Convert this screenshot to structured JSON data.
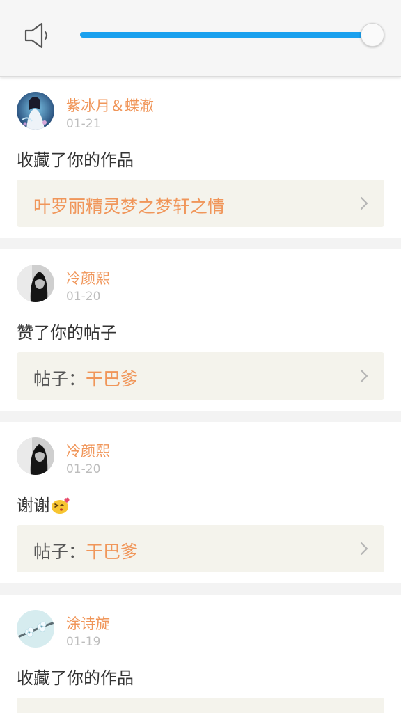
{
  "volume": {
    "level": 0.99,
    "icon": "speaker-icon",
    "accent_color": "#1aa0ee"
  },
  "feed": {
    "accent_color": "#f0965a",
    "items": [
      {
        "avatar": "avatar-woman-white-dress",
        "username": "紫冰月＆蝶澈",
        "date": "01-21",
        "action": "收藏了你的作品",
        "link_prefix": "",
        "link_title": "叶罗丽精灵梦之梦轩之情"
      },
      {
        "avatar": "avatar-bw-portrait",
        "username": "冷颜熙",
        "date": "01-20",
        "action": "赞了你的帖子",
        "link_prefix": "帖子：",
        "link_title": "干巴爹"
      },
      {
        "avatar": "avatar-bw-portrait",
        "username": "冷颜熙",
        "date": "01-20",
        "action": "谢谢",
        "action_emoji": "kiss-emoji",
        "link_prefix": "帖子：",
        "link_title": "干巴爹"
      },
      {
        "avatar": "avatar-blossom",
        "username": "涂诗旋",
        "date": "01-19",
        "action": "收藏了你的作品"
      }
    ]
  }
}
